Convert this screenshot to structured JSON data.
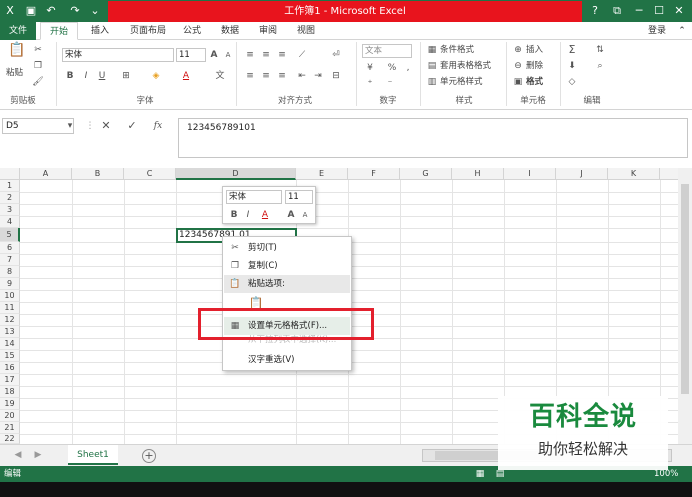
{
  "app": {
    "title": "工作簿1 - Microsoft Excel",
    "login": "登录",
    "help": "?"
  },
  "tabs": [
    "文件",
    "开始",
    "插入",
    "页面布局",
    "公式",
    "数据",
    "审阅",
    "视图"
  ],
  "ribbon": {
    "clipboard": {
      "label": "剪贴板",
      "paste": "粘贴"
    },
    "font": {
      "label": "字体",
      "name": "宋体",
      "size": "11",
      "bold": "B",
      "italic": "I",
      "underline": "U",
      "grow": "A",
      "shrink": "A",
      "color": "A"
    },
    "alignment": {
      "label": "对齐方式"
    },
    "number": {
      "label": "数字",
      "format": "文本",
      "percent": "%"
    },
    "styles": {
      "label": "样式",
      "conditional": "条件格式",
      "table": "套用表格格式",
      "cell": "单元格样式"
    },
    "cells": {
      "label": "单元格",
      "insert": "插入",
      "delete": "删除",
      "format": "格式"
    },
    "editing": {
      "label": "编辑"
    }
  },
  "formula_bar": {
    "name_box": "D5",
    "fx": "fx",
    "value": "123456789101"
  },
  "grid": {
    "columns": [
      "A",
      "B",
      "C",
      "D",
      "E",
      "F",
      "G",
      "H",
      "I",
      "J",
      "K"
    ],
    "rows": [
      "1",
      "2",
      "3",
      "4",
      "5",
      "6",
      "7",
      "8",
      "9",
      "10",
      "11",
      "12",
      "13",
      "14",
      "15",
      "16",
      "17",
      "18",
      "19",
      "20",
      "21",
      "22"
    ],
    "cell_d5": "1234567891 01"
  },
  "mini_toolbar": {
    "font": "宋体",
    "size": "11",
    "bold": "B",
    "italic": "I",
    "color": "A",
    "grow": "A",
    "shrink": "A"
  },
  "context_menu": {
    "cut": "剪切(T)",
    "copy": "复制(C)",
    "paste_options": "粘贴选项:",
    "format_cells": "设置单元格格式(F)...",
    "pick_list": "从下拉列表中选择(K)...",
    "hanzi": "汉字重选(V)"
  },
  "sheets": {
    "sheet1": "Sheet1",
    "add": "+"
  },
  "status": {
    "mode": "编辑",
    "zoom": "100%"
  },
  "watermark": {
    "title": "百科全说",
    "subtitle": "助你轻松解决"
  },
  "colors": {
    "excel_green": "#217346",
    "title_red": "#e8141d",
    "highlight_red": "#e3202d"
  }
}
